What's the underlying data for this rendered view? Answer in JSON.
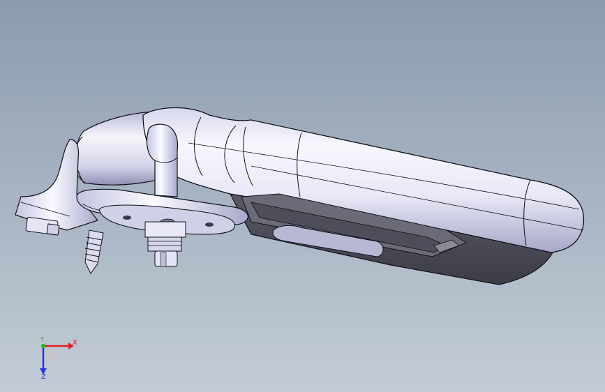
{
  "triad": {
    "x_label": "X",
    "y_label": "Y",
    "z_label": "Z",
    "colors": {
      "x": "#e02020",
      "y": "#19b919",
      "z": "#2838d8"
    }
  },
  "model": {
    "icon": "cad-part-model-icon"
  },
  "colors": {
    "background_top": "#8c9cae",
    "background_bottom": "#c3ccd6",
    "shade_light": "#f4f4fb",
    "shade_mid": "#c8c8e2",
    "shade_dark": "#4a4a5a",
    "edge": "#101018"
  }
}
